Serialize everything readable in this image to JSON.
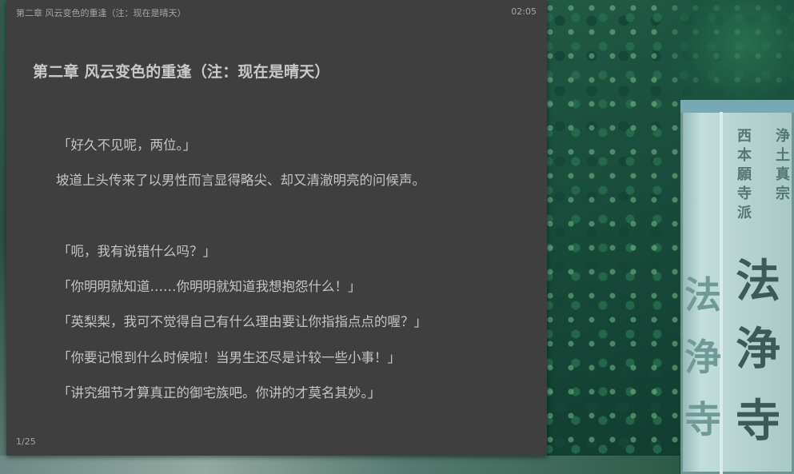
{
  "status_bar": {
    "chapter_title": "第二章 风云变色的重逢（注：现在是晴天）",
    "time": "02:05"
  },
  "chapter": {
    "heading": "第二章 风云变色的重逢（注：现在是晴天）"
  },
  "paragraphs": [
    "「好久不见呢，两位。」",
    "坡道上头传来了以男性而言显得略尖、却又清澈明亮的问候声。",
    "「呃，我有说错什么吗？」",
    "「你明明就知道……你明明就知道我想抱怨什么！」",
    "「英梨梨，我可不觉得自己有什么理由要让你指指点点的喔？」",
    "「你要记恨到什么时候啦！当男生还尽是计较一些小事！」",
    "「讲究细节才算真正的御宅族吧。你讲的才莫名其妙。」"
  ],
  "footer": {
    "page": "1/25"
  },
  "background": {
    "sign_small_chars_left": [
      "西",
      "本",
      "願",
      "寺",
      "派"
    ],
    "sign_small_chars_right": [
      "浄",
      "土",
      "真",
      "宗"
    ],
    "sign_big_chars": [
      "法",
      "浄",
      "寺"
    ],
    "sign_side_chars": [
      "法",
      "浄",
      "寺"
    ]
  },
  "colors": {
    "panel_bg": "#3f3f3f",
    "text": "#c4c4c4",
    "heading": "#c9c9c9",
    "status_text": "#a5a5a5"
  }
}
